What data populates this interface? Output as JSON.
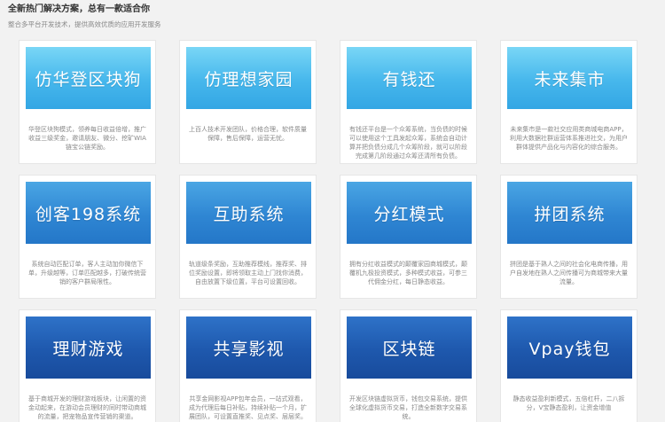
{
  "header": {
    "title": "全新热门解决方案，总有一款适合你",
    "subtitle": "整合多平台开发技术，提供高效优质的应用开发服务"
  },
  "cards": [
    {
      "id": "huadeng",
      "row": 0,
      "title": "仿华登区块狗",
      "desc": "华登区块狗模式，领养每日收益倍增，推广收益三级奖金，邀请朋友、微分、挖矿WIA链宝公链奖励。"
    },
    {
      "id": "lixiang",
      "row": 0,
      "title": "仿理想家园",
      "desc": "上百人技术开发团队，价格合理，软件质量保障，售后保障，运营无忧。"
    },
    {
      "id": "youqianhuan",
      "row": 0,
      "title": "有钱还",
      "desc": "有钱还平台是一个众筹系统，当负债的时候可以使用这个工具发起众筹，系统会自动计算并把负债分成几个众筹阶段，就可以阶段完成第几阶段通过众筹还清所有负债。"
    },
    {
      "id": "weilai",
      "row": 0,
      "title": "未来集市",
      "desc": "未来集市是一款社交应用类商城电商APP，利用大数据社群运营体系推进社交，为用户群体提供产品化与内容化的综合服务。"
    },
    {
      "id": "chuangke",
      "row": 1,
      "title": "创客198系统",
      "desc": "系统自动匹配订单，客人主动加你微信下单，升级越等，订单匹配越多，打破传统营销的客户群局限性。"
    },
    {
      "id": "huzhu",
      "row": 1,
      "title": "互助系统",
      "desc": "轨道级条奖励，互助推荐模线，推荐奖、排位奖励设置，即将领取主动上门找你消费，自由放置下级位置，平台可设置回收。"
    },
    {
      "id": "fenhong",
      "row": 1,
      "title": "分红模式",
      "desc": "拥有分红收益模式的颠覆家园商城模式，颠覆机九极投资模式，多种模式收益，可参三代佣金分红，每日静态收益。"
    },
    {
      "id": "pintuan",
      "row": 1,
      "title": "拼团系统",
      "desc": "拼团是基于熟人之间的社会化电商传播，用户自发地在熟人之间传播可为商城带来大量流量。"
    },
    {
      "id": "licai",
      "row": 2,
      "title": "理财游戏",
      "desc": "基于商城开发的理财游戏板块，让闲置的资金动起来，在游动会员理财的同时带动商城的流量，把宠物品宣传营销的渠道。"
    },
    {
      "id": "gongxiang",
      "row": 2,
      "title": "共享影视",
      "desc": "共享金网影视APP包年会员，一站式观看，成为代理后每日补贴，持续补贴一个月，扩展团队，可设置直推奖、见点奖、层层奖。"
    },
    {
      "id": "qukuailian",
      "row": 2,
      "title": "区块链",
      "desc": "开发区块链虚拟货币，钱包交易系统，提供全球化虚拟货币交易，打造全新数字交易系统。"
    },
    {
      "id": "vpay",
      "row": 2,
      "title": "Vpay钱包",
      "desc": "静态收益盈利新模式，五倍杠杆，二八拆分，V宝静态盈利，让资金增值"
    }
  ]
}
